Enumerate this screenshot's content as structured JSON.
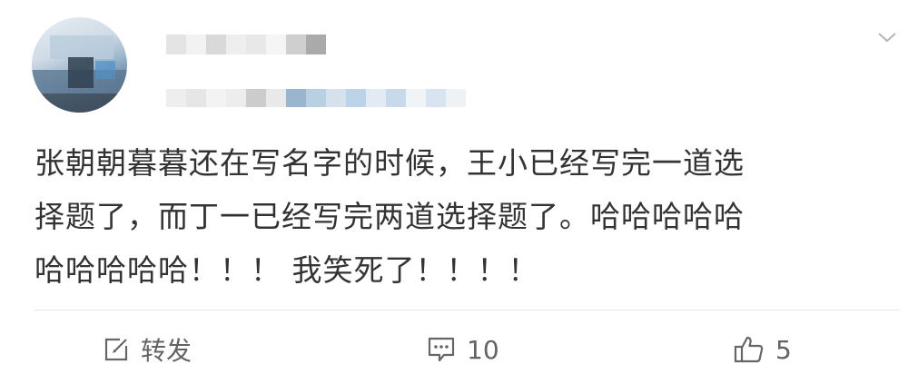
{
  "post": {
    "text_line1": "张朝朝暮暮还在写名字的时候，王小已经写完一道选",
    "text_line2": "择题了，而丁一已经写完两道选择题了。哈哈哈哈哈",
    "text_line3": "哈哈哈哈哈！！！ 我笑死了！！！！"
  },
  "actions": {
    "repost_label": "转发",
    "comment_count": "10",
    "like_count": "5"
  },
  "icons": {
    "menu": "chevron-down-icon",
    "repost": "edit-square-icon",
    "comment": "comment-bubble-icon",
    "like": "thumbs-up-icon"
  },
  "colors": {
    "text": "#333333",
    "action_text": "#636363",
    "divider": "#e6e6e6"
  }
}
